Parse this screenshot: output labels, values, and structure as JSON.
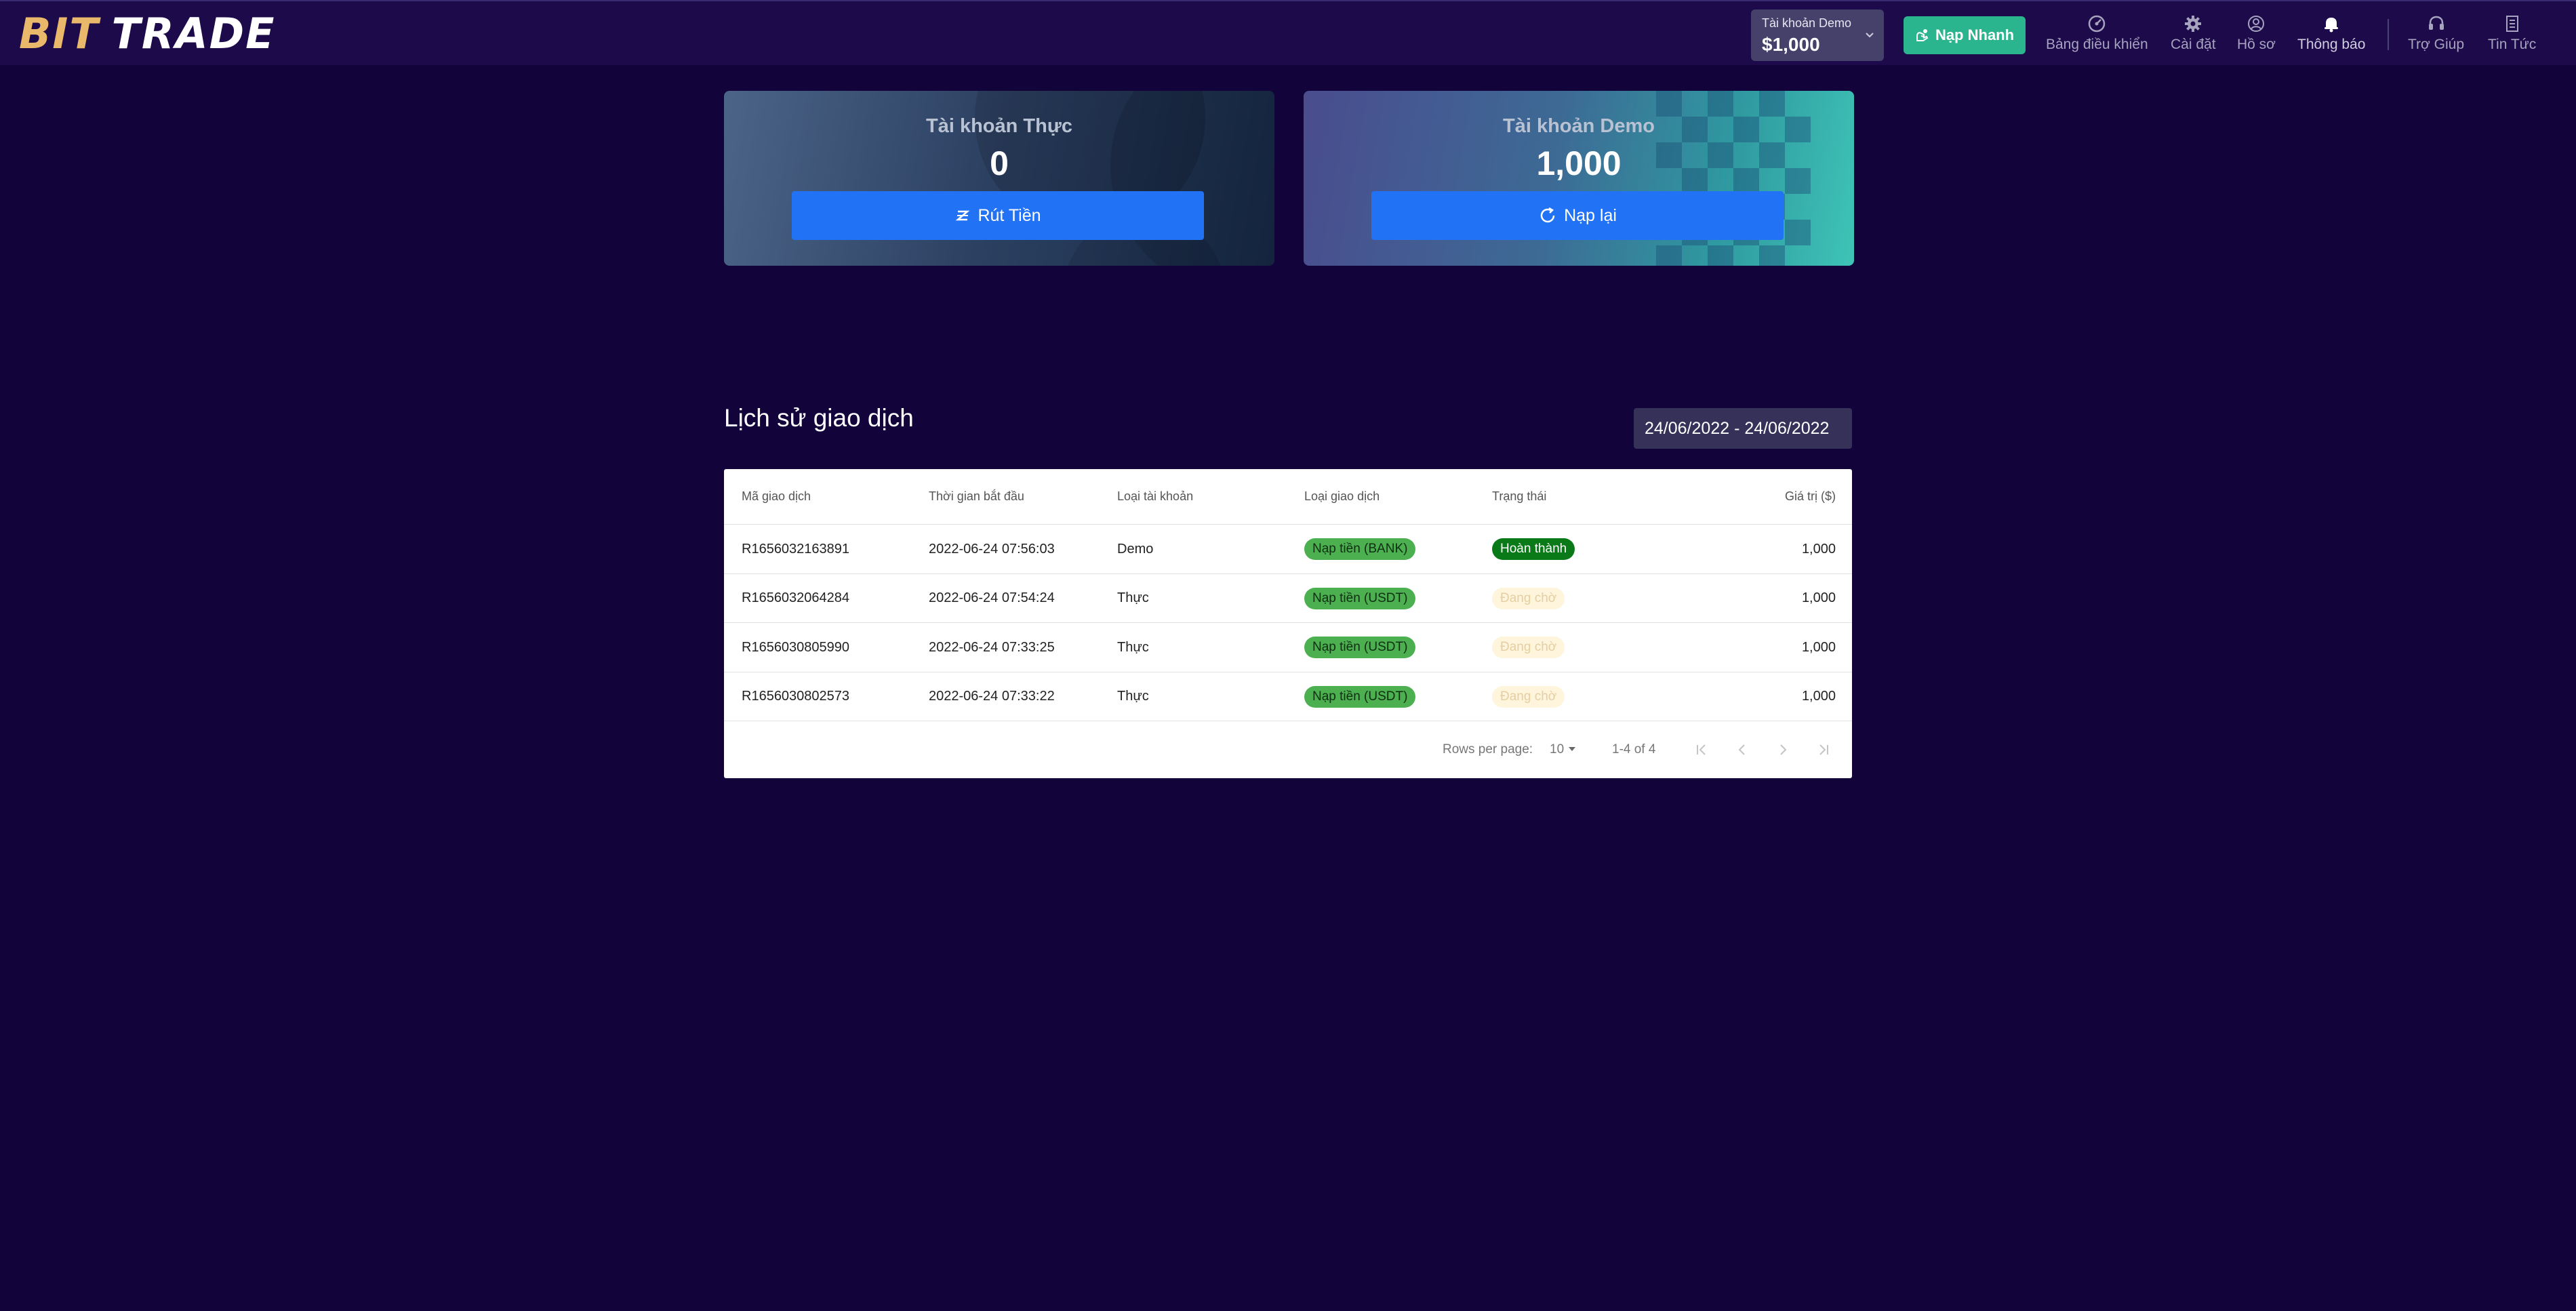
{
  "header": {
    "logo_part1": "BIT",
    "logo_part2": "TRADE",
    "account_switch": {
      "label": "Tài khoản Demo",
      "balance": "$1,000"
    },
    "deposit_button": "Nạp Nhanh",
    "nav": [
      {
        "label": "Bảng điều khiển",
        "icon": "dashboard-icon"
      },
      {
        "label": "Cài đặt",
        "icon": "gear-icon"
      },
      {
        "label": "Hồ sơ",
        "icon": "profile-icon"
      },
      {
        "label": "Thông báo",
        "icon": "bell-icon"
      },
      {
        "label": "Trợ Giúp",
        "icon": "headset-icon"
      },
      {
        "label": "Tin Tức",
        "icon": "news-icon"
      }
    ]
  },
  "cards": {
    "real": {
      "title": "Tài khoản Thực",
      "value": "0",
      "action": "Rút Tiền",
      "icon": "withdraw-icon"
    },
    "demo": {
      "title": "Tài khoản Demo",
      "value": "1,000",
      "action": "Nạp lại",
      "icon": "refresh-icon"
    }
  },
  "history": {
    "title": "Lịch sử giao dịch",
    "date_range": "24/06/2022 - 24/06/2022",
    "columns": [
      "Mã giao dịch",
      "Thời gian bắt đầu",
      "Loại tài khoản",
      "Loại giao dịch",
      "Trạng thái",
      "Giá trị ($)"
    ],
    "rows": [
      {
        "id": "R1656032163891",
        "time": "2022-06-24 07:56:03",
        "account": "Demo",
        "type": "Nạp tiền (BANK)",
        "status": "Hoàn thành",
        "status_kind": "done",
        "value": "1,000"
      },
      {
        "id": "R1656032064284",
        "time": "2022-06-24 07:54:24",
        "account": "Thực",
        "type": "Nạp tiền (USDT)",
        "status": "Đang chờ",
        "status_kind": "pending",
        "value": "1,000"
      },
      {
        "id": "R1656030805990",
        "time": "2022-06-24 07:33:25",
        "account": "Thực",
        "type": "Nạp tiền (USDT)",
        "status": "Đang chờ",
        "status_kind": "pending",
        "value": "1,000"
      },
      {
        "id": "R1656030802573",
        "time": "2022-06-24 07:33:22",
        "account": "Thực",
        "type": "Nạp tiền (USDT)",
        "status": "Đang chờ",
        "status_kind": "pending",
        "value": "1,000"
      }
    ],
    "pagination": {
      "rows_per_page_label": "Rows per page:",
      "rows_per_page": "10",
      "range": "1-4 of 4"
    }
  },
  "colors": {
    "background": "#12043a",
    "topbar": "#1d0a4a",
    "accent_blue": "#2272f5",
    "deposit_green": "#2bb58e",
    "status_done": "#0a7a18",
    "type_pill": "#4caf50",
    "pending_pill": "#fff4dc"
  }
}
